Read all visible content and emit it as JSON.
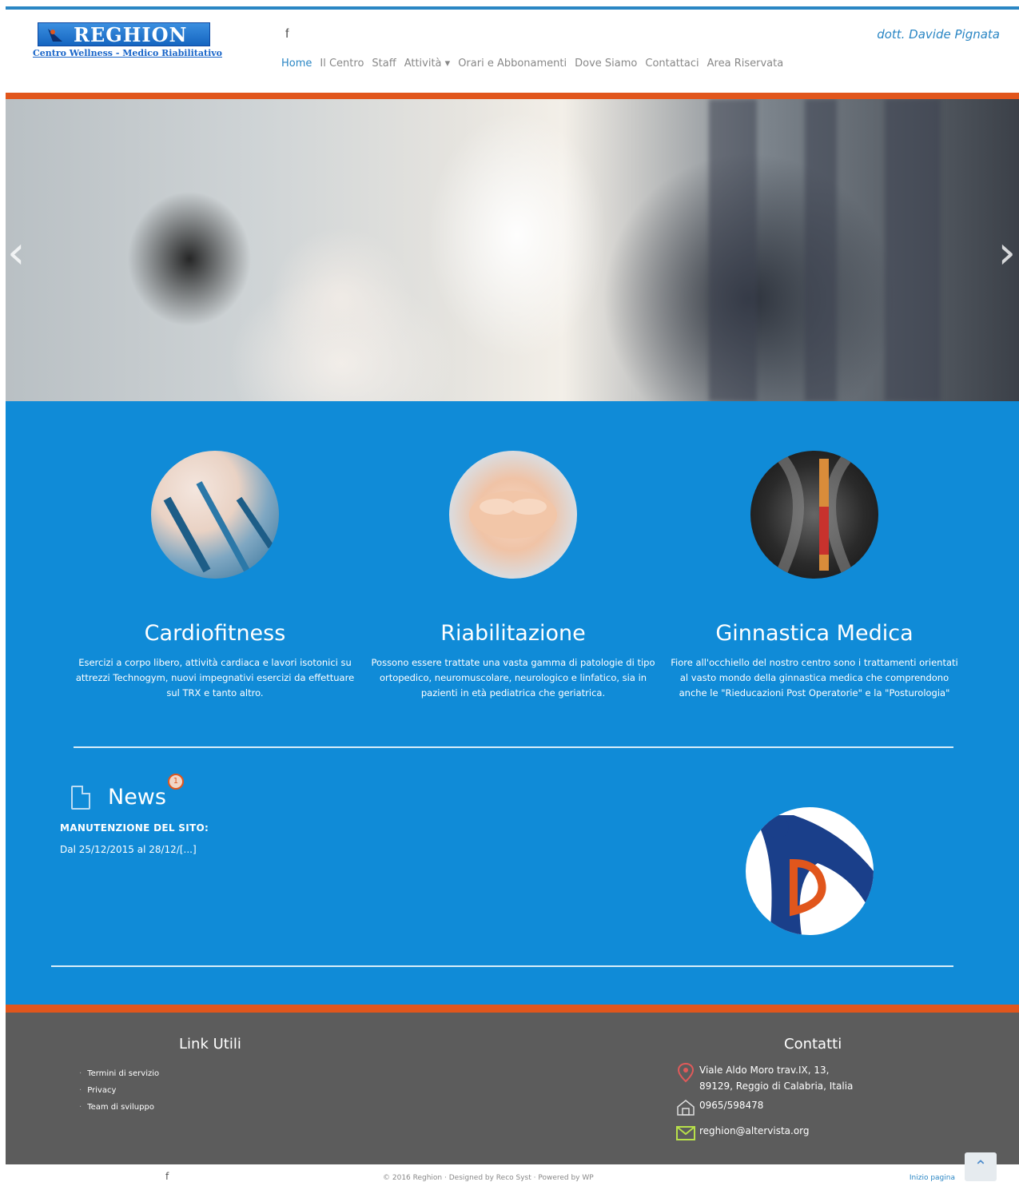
{
  "header": {
    "logo_title": "REGHION",
    "logo_subtitle": "Centro Wellness - Medico Riabilitativo",
    "facebook_label": "f",
    "doctor": "dott. Davide Pignata"
  },
  "nav": {
    "items": [
      "Home",
      "Il Centro",
      "Staff",
      "Attività ▾",
      "Orari e Abbonamenti",
      "Dove Siamo",
      "Contattaci",
      "Area Riservata"
    ],
    "active": "Home"
  },
  "hero": {
    "prev": "‹",
    "next": "›"
  },
  "features": [
    {
      "title": "Cardiofitness",
      "text": "Esercizi a corpo libero, attività cardiaca e lavori isotonici su attrezzi Technogym, nuovi impegnativi esercizi da effettuare sul TRX e tanto altro."
    },
    {
      "title": "Riabilitazione",
      "text": "Possono essere trattate una vasta gamma di patologie di tipo ortopedico, neuromuscolare, neurologico e linfatico, sia in pazienti in età pediatrica che geriatrica."
    },
    {
      "title": "Ginnastica Medica",
      "text": "Fiore all'occhiello del nostro centro sono i trattamenti orientati al vasto mondo della ginnastica medica che comprendono anche le \"Rieducazioni Post Operatorie\" e la \"Posturologia\""
    }
  ],
  "news": {
    "heading": "News",
    "badge": "1",
    "item_title": "MANUTENZIONE DEL SITO:",
    "item_text": "Dal 25/12/2015 al 28/12/[...]"
  },
  "footer": {
    "links_heading": "Link Utili",
    "links": [
      "Termini di servizio",
      "Privacy",
      "Team di sviluppo"
    ],
    "contact_heading": "Contatti",
    "address_line1": "Viale Aldo Moro trav.IX, 13,",
    "address_line2": "89129, Reggio di Calabria, Italia",
    "phone": "0965/598478",
    "email": "reghion@altervista.org"
  },
  "bottom": {
    "facebook_label": "f",
    "copyright": "© 2016 Reghion · Designed by Reco Syst · Powered by WP",
    "top_link": "Inizio pagina",
    "to_top": "⌃"
  },
  "colors": {
    "accent_blue": "#108bd7",
    "accent_orange": "#e1561c",
    "footer_gray": "#5c5c5c"
  }
}
